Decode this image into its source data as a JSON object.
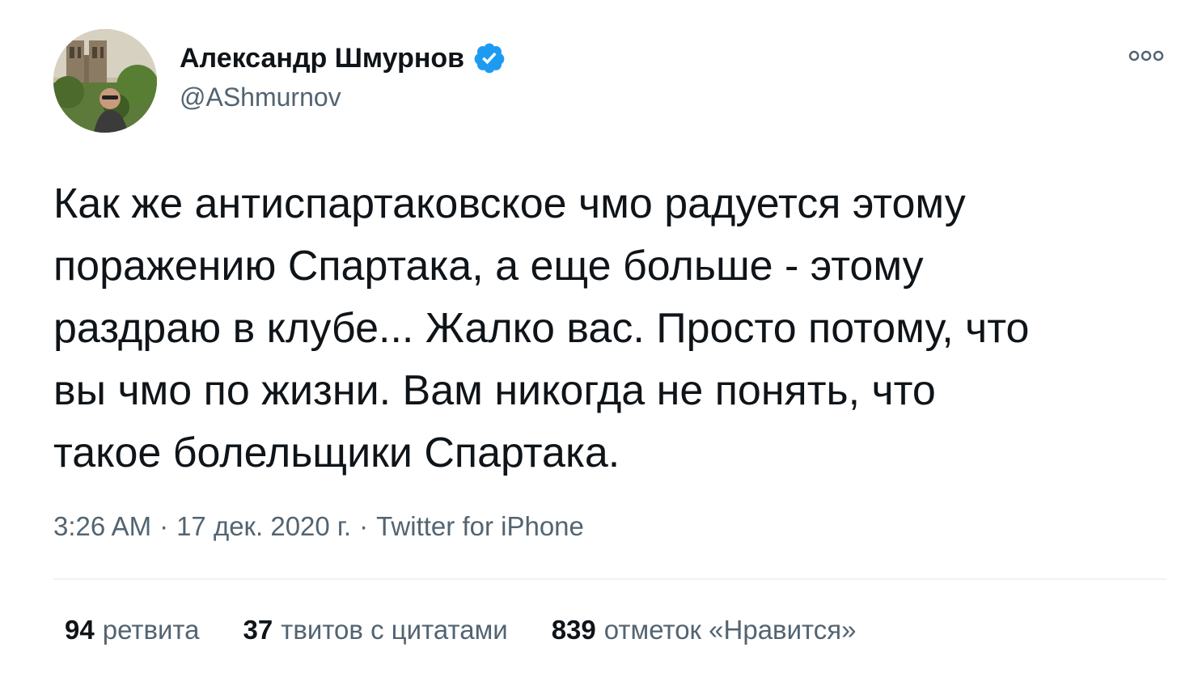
{
  "author": {
    "display_name": "Александр Шмурнов",
    "handle": "@AShmurnov",
    "verified": true,
    "verified_icon": "verified-badge-icon",
    "avatar_icon": "profile-photo"
  },
  "menu": {
    "more_icon": "more-options-icon"
  },
  "tweet": {
    "text": "Как же антиспартаковское чмо радуется этому\nпоражению Спартака, а еще больше - этому\nраздраю в клубе... Жалко вас. Просто потому, что\nвы чмо по жизни. Вам никогда не понять, что\nтакое болельщики Спартака."
  },
  "meta": {
    "time": "3:26 AM",
    "sep1": "·",
    "date": "17 дек. 2020 г.",
    "sep2": "·",
    "source": "Twitter for iPhone"
  },
  "stats": [
    {
      "count": "94",
      "label": "ретвита"
    },
    {
      "count": "37",
      "label": "твитов с цитатами"
    },
    {
      "count": "839",
      "label": "отметок «Нравится»"
    }
  ],
  "colors": {
    "text_primary": "#0f1419",
    "text_secondary": "#536471",
    "verified_blue": "#1d9bf0",
    "divider": "#eff3f4"
  }
}
